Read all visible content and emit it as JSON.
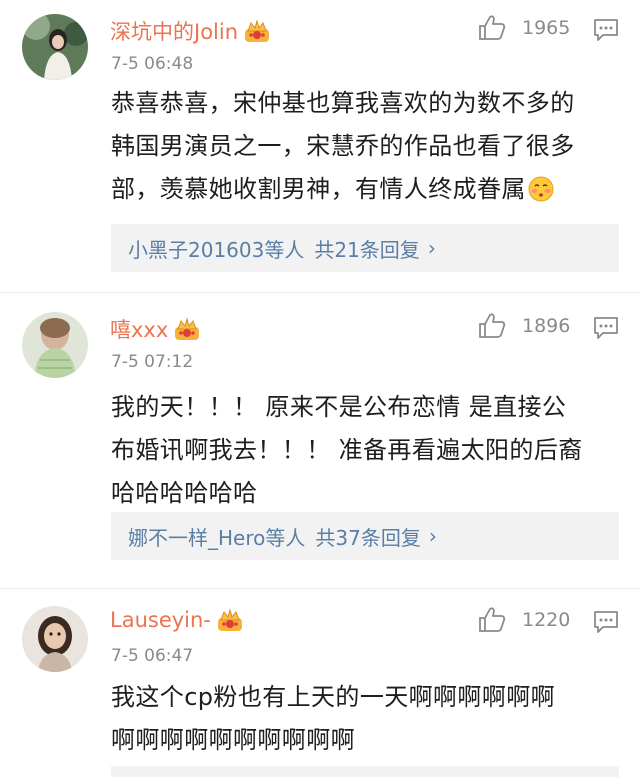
{
  "comments": [
    {
      "username": "深坑中的Jolin",
      "time": "7-5 06:48",
      "likes": "1965",
      "content_lines": [
        "恭喜恭喜，宋仲基也算我喜欢的为数不多的",
        "韩国男演员之一，宋慧乔的作品也看了很多",
        "部，羡慕她收割男神，有情人终成眷属"
      ],
      "emoji": "blushing-face",
      "reply_users": "小黑子201603等人",
      "reply_count": "共21条回复",
      "reply_arrow": "›"
    },
    {
      "username": "嘻xxx",
      "time": "7-5 07:12",
      "likes": "1896",
      "content_lines": [
        "我的天！！！ 原来不是公布恋情 是直接公",
        "布婚讯啊我去！！！ 准备再看遍太阳的后裔",
        "哈哈哈哈哈哈"
      ],
      "reply_users": "娜不一样_Hero等人",
      "reply_count": "共37条回复",
      "reply_arrow": "›"
    },
    {
      "username": "Lauseyin-",
      "time": "7-5 06:47",
      "likes": "1220",
      "content_lines": [
        "我这个cp粉也有上天的一天啊啊啊啊啊啊",
        "啊啊啊啊啊啊啊啊啊啊"
      ]
    }
  ],
  "icons": {
    "like": "thumbs-up-icon",
    "reply": "comment-icon",
    "vip": "crown-badge-icon"
  },
  "colors": {
    "username": "#eb7350",
    "link": "#5b7ea6",
    "meta": "#8a8a8a",
    "reply_bg": "#f2f2f2"
  }
}
